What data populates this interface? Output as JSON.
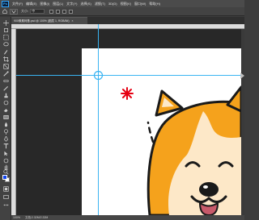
{
  "app": {
    "logo_text": "Ps"
  },
  "menubar": {
    "items": [
      "文件(F)",
      "编辑(E)",
      "图像(I)",
      "图层(L)",
      "文字(Y)",
      "选择(S)",
      "滤镜(T)",
      "3D(D)",
      "视图(V)",
      "窗口(W)",
      "帮助(H)"
    ]
  },
  "optionsbar": {
    "size_label": "大小:",
    "size_value": "中",
    "checkbox_count": 4
  },
  "document": {
    "tab_title": "900像素柯基.psd @ 100% (图层 1, RGB/8#)",
    "close_glyph": "×"
  },
  "statusbar": {
    "zoom": "100%",
    "doc_info": "文档:2.32M/2.32M"
  },
  "colors": {
    "foreground": "#1144ee",
    "background": "#ffffff",
    "guide": "#3ab4f2",
    "accent_red": "#e60012",
    "fur_orange": "#f5a21c",
    "fur_cream": "#fde8c8",
    "outline": "#1a1a1a"
  },
  "tools": [
    "move-tool",
    "artboard-tool",
    "marquee-tool",
    "lasso-tool",
    "quick-select-tool",
    "crop-tool",
    "frame-tool",
    "eyedropper-tool",
    "healing-brush-tool",
    "brush-tool",
    "clone-stamp-tool",
    "history-brush-tool",
    "eraser-tool",
    "gradient-tool",
    "blur-tool",
    "dodge-tool",
    "pen-tool",
    "type-tool",
    "path-select-tool",
    "shape-tool",
    "hand-tool",
    "zoom-tool",
    "more-tools"
  ]
}
